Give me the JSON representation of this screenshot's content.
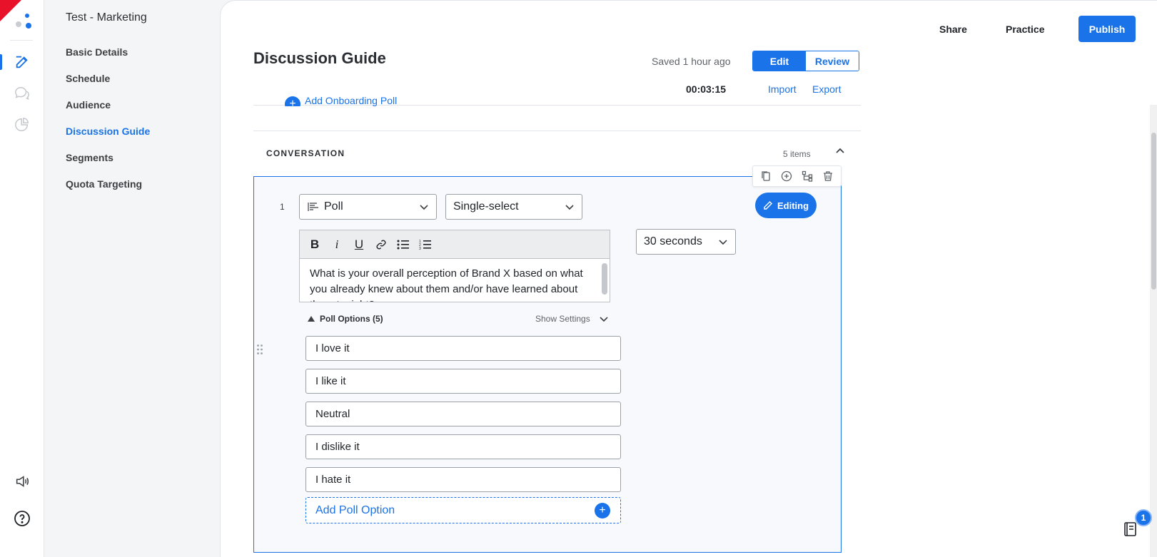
{
  "app": {
    "project_title": "Test - Marketing"
  },
  "nav": {
    "items": [
      {
        "label": "Basic Details",
        "active": false
      },
      {
        "label": "Schedule",
        "active": false
      },
      {
        "label": "Audience",
        "active": false
      },
      {
        "label": "Discussion Guide",
        "active": true
      },
      {
        "label": "Segments",
        "active": false
      },
      {
        "label": "Quota Targeting",
        "active": false
      }
    ]
  },
  "topbar": {
    "share": "Share",
    "practice": "Practice",
    "publish": "Publish"
  },
  "page": {
    "title": "Discussion Guide",
    "saved_status": "Saved 1 hour ago",
    "mode_edit": "Edit",
    "mode_review": "Review",
    "timer": "00:03:15",
    "import": "Import",
    "export": "Export",
    "onboarding_link": "Add Onboarding Poll"
  },
  "section": {
    "label": "CONVERSATION",
    "count": "5 items"
  },
  "item": {
    "number": "1",
    "type": "Poll",
    "select_mode": "Single-select",
    "duration": "30 seconds",
    "editing_label": "Editing",
    "question": "What is your overall perception of Brand X based on what you already knew about them and/or have learned about them tonight?",
    "poll_options_header": "Poll Options (5)",
    "show_settings": "Show Settings",
    "options": [
      "I love it",
      "I like it",
      "Neutral",
      "I dislike it",
      "I hate it"
    ],
    "add_option": "Add Poll Option"
  },
  "notifications": {
    "badge_count": "1"
  },
  "colors": {
    "accent": "#1a73e8",
    "brand_red": "#e8132a"
  }
}
